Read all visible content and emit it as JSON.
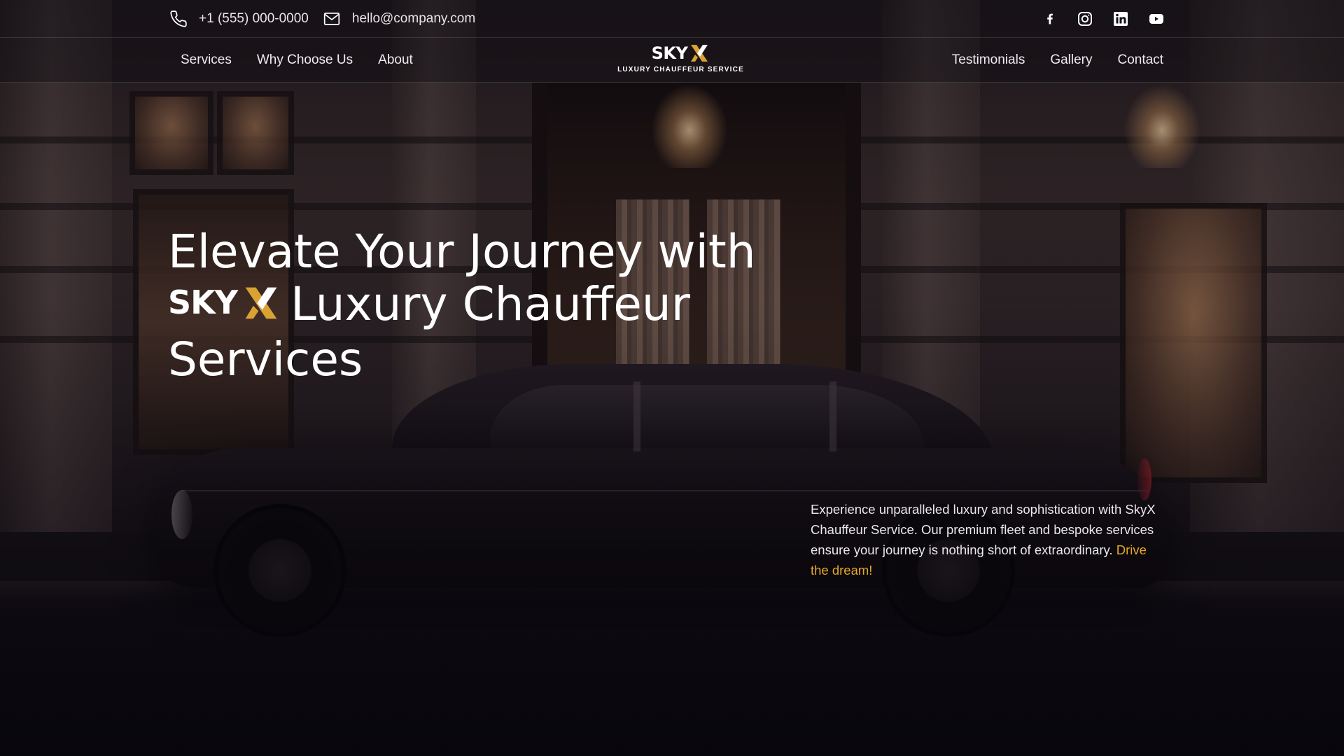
{
  "topbar": {
    "phone": "+1 (555) 000-0000",
    "email": "hello@company.com",
    "social": [
      {
        "icon": "facebook-icon"
      },
      {
        "icon": "instagram-icon"
      },
      {
        "icon": "linkedin-icon"
      },
      {
        "icon": "youtube-icon"
      }
    ]
  },
  "nav": {
    "left": [
      "Services",
      "Why Choose Us",
      "About"
    ],
    "right": [
      "Testimonials",
      "Gallery",
      "Contact"
    ]
  },
  "logo": {
    "word": "SKY",
    "tagline": "LUXURY CHAUFFEUR SERVICE"
  },
  "hero": {
    "line1": "Elevate Your Journey with",
    "brand_word": "SKY",
    "line2_rest": "Luxury Chauffeur",
    "line3": "Services",
    "lede": "Experience unparalleled luxury and sophistication with SkyX Chauffeur Service. Our premium fleet and bespoke services ensure your journey is nothing short of extraordinary.",
    "cta": "Drive the dream!"
  },
  "colors": {
    "accent": "#e6a72a",
    "text": "#ffffff",
    "background": "#0e0b10"
  }
}
